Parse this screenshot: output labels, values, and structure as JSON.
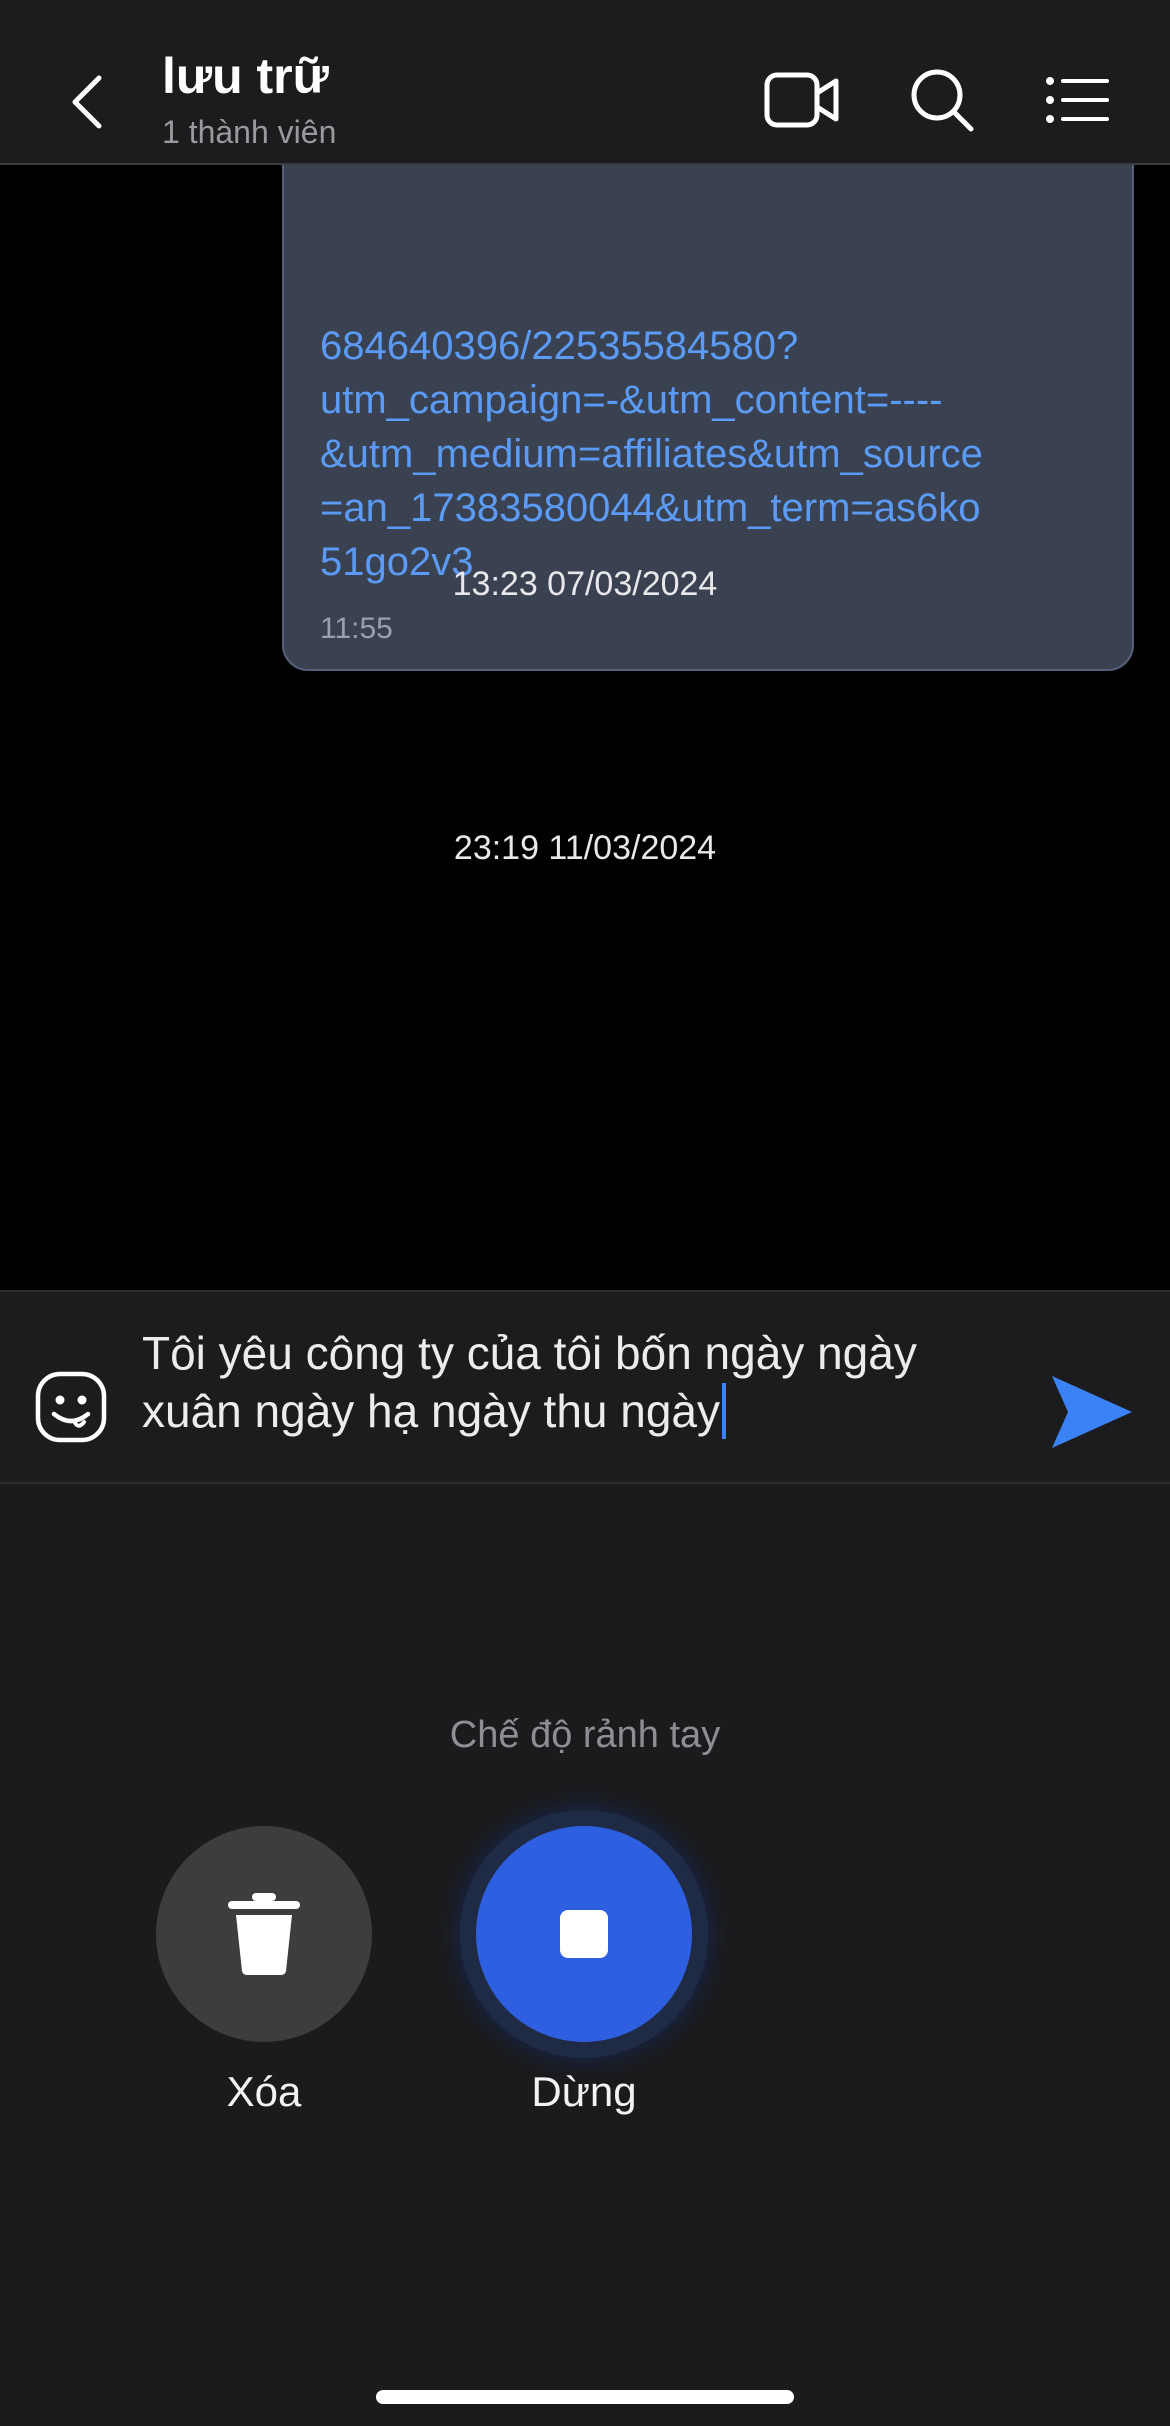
{
  "header": {
    "title": "lưu trữ",
    "subtitle": "1 thành viên",
    "icons": [
      "chevron-left-icon",
      "video-call-icon",
      "search-icon",
      "list-menu-icon"
    ]
  },
  "messages": {
    "bubble": {
      "link_lines": [
        "684640396/22535584580?",
        "utm_campaign=-&utm_content=----",
        "&utm_medium=affiliates&utm_source",
        "=an_17383580044&utm_term=as6ko",
        "51go2v3"
      ],
      "time": "11:55"
    },
    "date_separators": [
      "13:23 07/03/2024",
      "23:19 11/03/2024"
    ]
  },
  "composer": {
    "text_lines": [
      "Tôi yêu công ty của tôi bốn ngày ngày",
      "xuân ngày hạ ngày thu ngày"
    ],
    "emoji_icon": "emoji-face-icon",
    "send_icon": "send-arrow-icon"
  },
  "voice_panel": {
    "mode_label": "Chế độ rảnh tay",
    "delete_label": "Xóa",
    "stop_label": "Dừng",
    "delete_icon": "trash-icon",
    "stop_icon": "stop-icon"
  },
  "colors": {
    "link": "#5b9bf5",
    "accent": "#2d5fe0",
    "send": "#3b82f6",
    "bubble": "#3a4150"
  }
}
